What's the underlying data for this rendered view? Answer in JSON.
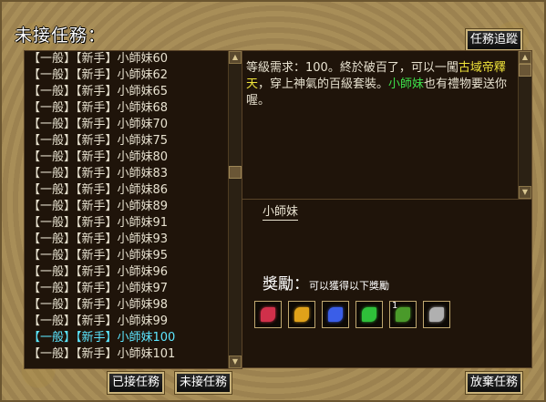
{
  "window": {
    "title": "未接任務：",
    "track_button": "任務追蹤"
  },
  "quest_list": {
    "items": [
      {
        "label": "【一般】【新手】小師妹60",
        "selected": false
      },
      {
        "label": "【一般】【新手】小師妹62",
        "selected": false
      },
      {
        "label": "【一般】【新手】小師妹65",
        "selected": false
      },
      {
        "label": "【一般】【新手】小師妹68",
        "selected": false
      },
      {
        "label": "【一般】【新手】小師妹70",
        "selected": false
      },
      {
        "label": "【一般】【新手】小師妹75",
        "selected": false
      },
      {
        "label": "【一般】【新手】小師妹80",
        "selected": false
      },
      {
        "label": "【一般】【新手】小師妹83",
        "selected": false
      },
      {
        "label": "【一般】【新手】小師妹86",
        "selected": false
      },
      {
        "label": "【一般】【新手】小師妹89",
        "selected": false
      },
      {
        "label": "【一般】【新手】小師妹91",
        "selected": false
      },
      {
        "label": "【一般】【新手】小師妹93",
        "selected": false
      },
      {
        "label": "【一般】【新手】小師妹95",
        "selected": false
      },
      {
        "label": "【一般】【新手】小師妹96",
        "selected": false
      },
      {
        "label": "【一般】【新手】小師妹97",
        "selected": false
      },
      {
        "label": "【一般】【新手】小師妹98",
        "selected": false
      },
      {
        "label": "【一般】【新手】小師妹99",
        "selected": false
      },
      {
        "label": "【一般】【新手】小師妹100",
        "selected": true
      },
      {
        "label": "【一般】【新手】小師妹101",
        "selected": false
      }
    ]
  },
  "description": {
    "part1": "等級需求：100。終於破百了，可以一闖",
    "place": "古域帝釋天",
    "part2": "，穿上神氣的百級套裝。",
    "npc_name": "小師妹",
    "part3": "也有禮物要送你喔。"
  },
  "detail": {
    "npc_link": "小師妹",
    "reward_title": "獎勵：",
    "reward_subtitle": "可以獲得以下獎勵",
    "reward_items": [
      {
        "icon": "red-gem-icon",
        "color": "#d0304a",
        "count": ""
      },
      {
        "icon": "gold-scroll-icon",
        "color": "#e0a21a",
        "count": ""
      },
      {
        "icon": "blue-crystal-icon",
        "color": "#3a5ee8",
        "count": ""
      },
      {
        "icon": "green-gem-icon",
        "color": "#2fc03a",
        "count": ""
      },
      {
        "icon": "green-pod-icon",
        "color": "#4a9a2a",
        "count": "1"
      },
      {
        "icon": "armor-icon",
        "color": "#b0b0b0",
        "count": ""
      }
    ]
  },
  "footer": {
    "accepted_button": "已接任務",
    "unaccepted_button": "未接任務",
    "abandon_button": "放棄任務"
  }
}
